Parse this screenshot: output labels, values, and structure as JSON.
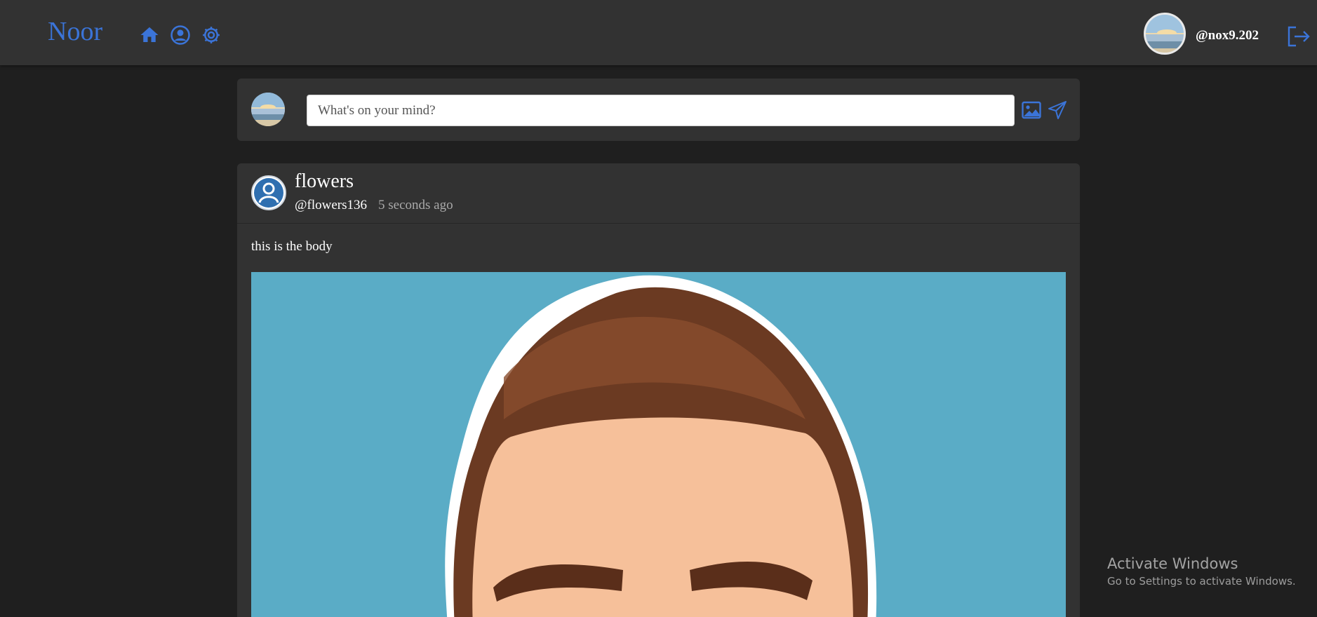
{
  "app": {
    "brand": "Noor",
    "accent_color": "#3b74d8"
  },
  "navbar": {
    "icons": [
      "home-icon",
      "profile-icon",
      "settings-icon"
    ],
    "user_handle": "@nox9.202",
    "logout_icon": "logout-icon"
  },
  "composer": {
    "placeholder": "What's on your mind?",
    "value": "",
    "icons": [
      "image-icon",
      "send-icon"
    ]
  },
  "post": {
    "name": "flowers",
    "handle": "@flowers136",
    "time": "5 seconds ago",
    "body": "this is the body"
  },
  "watermark": {
    "title": "Activate Windows",
    "subtitle": "Go to Settings to activate Windows."
  }
}
